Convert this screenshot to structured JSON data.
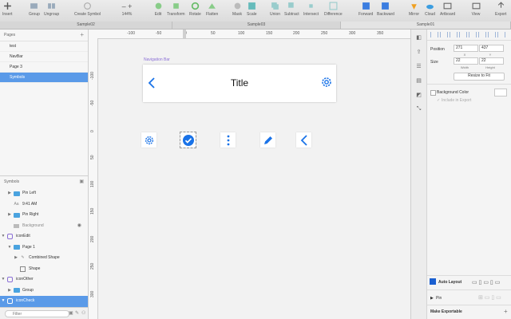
{
  "toolbar": {
    "items": [
      "Insert",
      "Group",
      "Ungroup",
      "Create Symbol",
      "144%",
      "Edit",
      "Transform",
      "Rotate",
      "Flatten",
      "Mask",
      "Scale",
      "Union",
      "Subtract",
      "Intersect",
      "Difference",
      "Forward",
      "Backward",
      "Mirror",
      "Cloud",
      "Artboard",
      "View",
      "Export"
    ]
  },
  "tabs": [
    "Sample02",
    "Sample03",
    "Sample01"
  ],
  "pages": {
    "header": "Pages",
    "items": [
      "test",
      "NavBar",
      "Page 3",
      "Symbols"
    ]
  },
  "layers": {
    "header": "Symbols",
    "items": [
      {
        "label": "Pin Left",
        "kind": "folder",
        "indent": 1
      },
      {
        "label": "9:41 AM",
        "kind": "text",
        "indent": 1
      },
      {
        "label": "Pin Right",
        "kind": "folder",
        "indent": 1
      },
      {
        "label": "Background",
        "kind": "shape",
        "indent": 1
      },
      {
        "label": "iconEdit",
        "kind": "symbol",
        "indent": 0
      },
      {
        "label": "Page 1",
        "kind": "folder",
        "indent": 1
      },
      {
        "label": "Combined Shape",
        "kind": "pen",
        "indent": 2
      },
      {
        "label": "Shape",
        "kind": "rect",
        "indent": 2
      },
      {
        "label": "iconOther",
        "kind": "symbol",
        "indent": 0
      },
      {
        "label": "Group",
        "kind": "folder",
        "indent": 1
      },
      {
        "label": "iconCheck",
        "kind": "symbol",
        "indent": 0
      }
    ],
    "filter_placeholder": "Filter"
  },
  "canvas": {
    "ruler_h": [
      "-100",
      "-50",
      "0",
      "50",
      "100",
      "150",
      "200",
      "250",
      "300",
      "350"
    ],
    "ruler_v": [
      "-100",
      "-50",
      "0",
      "50",
      "100",
      "150",
      "200",
      "250",
      "300"
    ],
    "artboard_label": "Navigation Bar",
    "title": "Title"
  },
  "inspector": {
    "position_label": "Position",
    "x_value": "271",
    "y_value": "437",
    "x_label": "X",
    "y_label": "Y",
    "size_label": "Size",
    "w_value": "22",
    "h_value": "22",
    "w_label": "Width",
    "h_label": "Height",
    "resize_label": "Resize to Fit",
    "bg_color_label": "Background Color",
    "include_export_label": "Include in Export",
    "auto_layout_label": "Auto Layout",
    "pin_label": "Pin",
    "make_exportable_label": "Make Exportable"
  },
  "colors": {
    "accent": "#1a73e8",
    "selection": "#5a9ae8",
    "symbol": "#8b6fd6"
  }
}
